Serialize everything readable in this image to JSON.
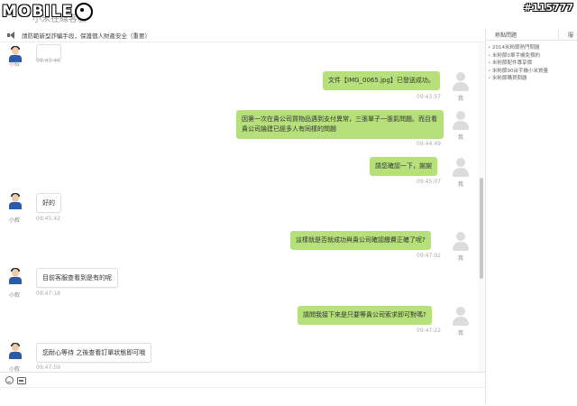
{
  "watermark": {
    "logo_text": "MOBILE01",
    "post_id": "#115777"
  },
  "header": {
    "title": "小米在線客服"
  },
  "notice": {
    "text": "請防範新型詐騙手段，保護個人財產安全（重要）"
  },
  "labels": {
    "agent": "小叙",
    "me": "我"
  },
  "messages": [
    {
      "side": "left",
      "sender": "小叙",
      "text": "",
      "time": "09:43:46"
    },
    {
      "side": "right",
      "sender": "我",
      "text": "文件【IMG_0065.jpg】已發送成功。",
      "time": "09:43:57"
    },
    {
      "side": "right",
      "sender": "我",
      "text": "因第一次在貴公司買物品遇到支付異常，三張單子一張氣問題。而且看貴公司論建已經多人有同樣的問題",
      "time": "09:44:49"
    },
    {
      "side": "right",
      "sender": "我",
      "text": "請您確認一下，謝謝",
      "time": "09:45:07"
    },
    {
      "side": "left",
      "sender": "小叙",
      "text": "好的",
      "time": "09:45:42"
    },
    {
      "side": "right",
      "sender": "我",
      "text": "這樣就是否就成功與貴公司確認繳費正確了呢?",
      "time": "09:47:02"
    },
    {
      "side": "left",
      "sender": "小叙",
      "text": "目前客服查看到是有的呢",
      "time": "09:47:18"
    },
    {
      "side": "right",
      "sender": "我",
      "text": "請問我接下來是只要等貴公司索求即可對嗎?",
      "time": "09:47:22"
    },
    {
      "side": "left",
      "sender": "小叙",
      "text": "您耐心等待 之後查看訂單狀態即可哦",
      "time": "09:47:59"
    }
  ],
  "right_panel": {
    "tab_hot": "熱點問題",
    "tab_other": "服",
    "items": [
      "2014米粉節熱門問題",
      "米粉節0單手機免預約",
      "米粉節配件專享價",
      "米粉節90台手機小米質量",
      "米粉節購買問題"
    ]
  },
  "icons": {
    "composer": [
      "emoji-icon",
      "image-icon"
    ],
    "notice": "speaker-icon"
  },
  "colors": {
    "my_bubble": "#b5e07a",
    "agent_bubble": "#ffffff",
    "agent_shirt": "#2a5aa8"
  }
}
